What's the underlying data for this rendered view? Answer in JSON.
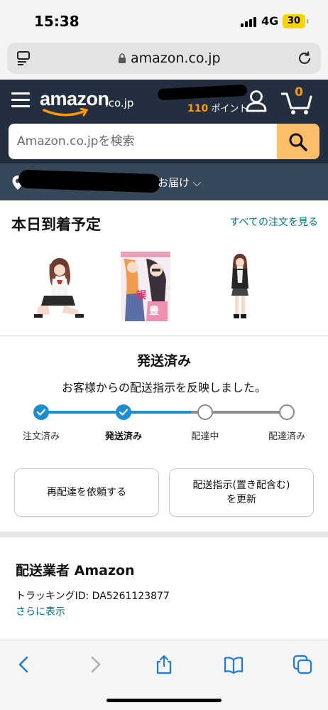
{
  "status_bar": {
    "time": "15:38",
    "network": "4G",
    "battery": "30"
  },
  "browser": {
    "url": "amazon.co.jp"
  },
  "header": {
    "logo_word": "amazon",
    "logo_tld": ".co.jp",
    "points_value": "110",
    "points_label": "ポイント",
    "cart_count": "0"
  },
  "search": {
    "placeholder": "Amazon.co.jpを検索"
  },
  "deliver": {
    "label": "お届け ⌵"
  },
  "arrival": {
    "title": "本日到着予定",
    "all_orders_link": "すべての注文を見る"
  },
  "shipment": {
    "title": "発送済み",
    "subtitle": "お客様からの配送指示を反映しました。",
    "steps": [
      {
        "label": "注文済み",
        "done": true,
        "current": false
      },
      {
        "label": "発送済み",
        "done": true,
        "current": true
      },
      {
        "label": "配達中",
        "done": false,
        "current": false
      },
      {
        "label": "配達済み",
        "done": false,
        "current": false
      }
    ],
    "progress_done_steps": 2
  },
  "actions": {
    "redelivery": "再配達を依頼する",
    "update_instructions": "配送指示(置き配含む)\nを更新"
  },
  "carrier": {
    "title": "配送業者 Amazon",
    "tracking": "トラッキングID: DA5261123877",
    "show_more": "さらに表示"
  },
  "colors": {
    "header_bg": "#232f3e",
    "deliver_bg": "#37475a",
    "search_button": "#febd69",
    "accent_orange": "#ff9900",
    "link": "#007185",
    "progress_blue": "#1a8ed1"
  }
}
